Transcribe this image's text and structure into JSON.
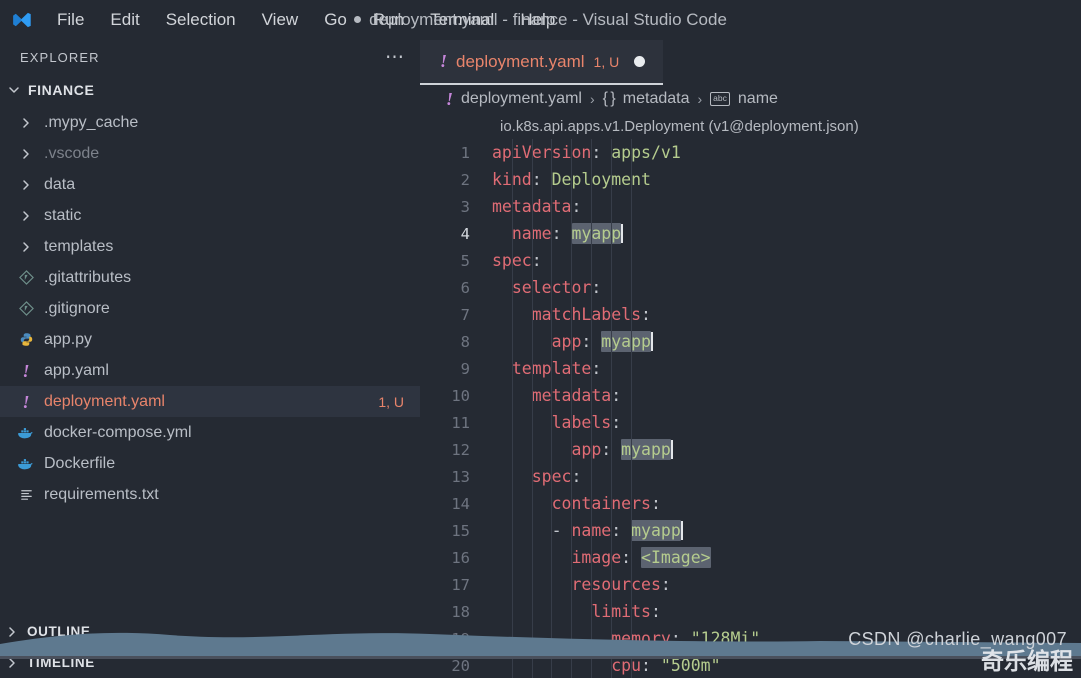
{
  "titlebar": {
    "logo_icon": "vscode-logo-icon",
    "menus": [
      "File",
      "Edit",
      "Selection",
      "View",
      "Go",
      "Run",
      "Terminal",
      "Help"
    ],
    "window_title": "deployment.yaml - finance - Visual Studio Code",
    "dirty_indicator": "●"
  },
  "sidebar": {
    "header_label": "EXPLORER",
    "more_actions_icon": "ellipsis-icon",
    "project": {
      "label": "FINANCE",
      "expanded": true,
      "chevron_icon": "chevron-down-icon"
    },
    "items": [
      {
        "label": ".mypy_cache",
        "type": "folder",
        "icon": "chevron-right-icon",
        "dim": false,
        "selected": false,
        "badge": ""
      },
      {
        "label": ".vscode",
        "type": "folder",
        "icon": "chevron-right-icon",
        "dim": true,
        "selected": false,
        "badge": ""
      },
      {
        "label": "data",
        "type": "folder",
        "icon": "chevron-right-icon",
        "dim": false,
        "selected": false,
        "badge": ""
      },
      {
        "label": "static",
        "type": "folder",
        "icon": "chevron-right-icon",
        "dim": false,
        "selected": false,
        "badge": ""
      },
      {
        "label": "templates",
        "type": "folder",
        "icon": "chevron-right-icon",
        "dim": false,
        "selected": false,
        "badge": ""
      },
      {
        "label": ".gitattributes",
        "type": "file",
        "icon": "git-icon",
        "dim": false,
        "selected": false,
        "badge": ""
      },
      {
        "label": ".gitignore",
        "type": "file",
        "icon": "git-icon",
        "dim": false,
        "selected": false,
        "badge": ""
      },
      {
        "label": "app.py",
        "type": "file",
        "icon": "python-icon",
        "dim": false,
        "selected": false,
        "badge": ""
      },
      {
        "label": "app.yaml",
        "type": "file",
        "icon": "yaml-warning-icon",
        "dim": false,
        "selected": false,
        "badge": ""
      },
      {
        "label": "deployment.yaml",
        "type": "file",
        "icon": "yaml-warning-icon",
        "dim": false,
        "selected": true,
        "badge": "1, U"
      },
      {
        "label": "docker-compose.yml",
        "type": "file",
        "icon": "docker-icon",
        "dim": false,
        "selected": false,
        "badge": ""
      },
      {
        "label": "Dockerfile",
        "type": "file",
        "icon": "docker-icon",
        "dim": false,
        "selected": false,
        "badge": ""
      },
      {
        "label": "requirements.txt",
        "type": "file",
        "icon": "text-lines-icon",
        "dim": false,
        "selected": false,
        "badge": ""
      }
    ],
    "panels": [
      {
        "label": "OUTLINE",
        "icon": "chevron-right-icon"
      },
      {
        "label": "TIMELINE",
        "icon": "chevron-right-icon"
      }
    ]
  },
  "editor": {
    "tab": {
      "icon": "yaml-warning-icon",
      "name": "deployment.yaml",
      "badge": "1, U",
      "dirty_icon": "dirty-dot-icon"
    },
    "breadcrumb": {
      "file_icon": "yaml-warning-icon",
      "file": "deployment.yaml",
      "separator": "›",
      "object_icon": "{ }",
      "object": "metadata",
      "symbol_icon": "abc",
      "symbol": "name"
    },
    "type_info": "io.k8s.api.apps.v1.Deployment (v1@deployment.json)",
    "active_line": 4,
    "lines": [
      {
        "n": "1",
        "indent": 0,
        "tokens": [
          {
            "t": "apiVersion",
            "c": "k"
          },
          {
            "t": ": ",
            "c": "p"
          },
          {
            "t": "apps/v1",
            "c": "v"
          }
        ]
      },
      {
        "n": "2",
        "indent": 0,
        "tokens": [
          {
            "t": "kind",
            "c": "k"
          },
          {
            "t": ": ",
            "c": "p"
          },
          {
            "t": "Deployment",
            "c": "v"
          }
        ]
      },
      {
        "n": "3",
        "indent": 0,
        "tokens": [
          {
            "t": "metadata",
            "c": "k"
          },
          {
            "t": ":",
            "c": "p"
          }
        ]
      },
      {
        "n": "4",
        "indent": 1,
        "tokens": [
          {
            "t": "name",
            "c": "k"
          },
          {
            "t": ": ",
            "c": "p"
          },
          {
            "t": "myapp",
            "c": "v",
            "sel": true,
            "caret": true
          }
        ]
      },
      {
        "n": "5",
        "indent": 0,
        "tokens": [
          {
            "t": "spec",
            "c": "k"
          },
          {
            "t": ":",
            "c": "p"
          }
        ]
      },
      {
        "n": "6",
        "indent": 1,
        "tokens": [
          {
            "t": "selector",
            "c": "k"
          },
          {
            "t": ":",
            "c": "p"
          }
        ]
      },
      {
        "n": "7",
        "indent": 2,
        "tokens": [
          {
            "t": "matchLabels",
            "c": "k"
          },
          {
            "t": ":",
            "c": "p"
          }
        ]
      },
      {
        "n": "8",
        "indent": 3,
        "tokens": [
          {
            "t": "app",
            "c": "k"
          },
          {
            "t": ": ",
            "c": "p"
          },
          {
            "t": "myapp",
            "c": "v",
            "sel": true,
            "caret": true
          }
        ]
      },
      {
        "n": "9",
        "indent": 1,
        "tokens": [
          {
            "t": "template",
            "c": "k"
          },
          {
            "t": ":",
            "c": "p"
          }
        ]
      },
      {
        "n": "10",
        "indent": 2,
        "tokens": [
          {
            "t": "metadata",
            "c": "k"
          },
          {
            "t": ":",
            "c": "p"
          }
        ]
      },
      {
        "n": "11",
        "indent": 3,
        "tokens": [
          {
            "t": "labels",
            "c": "k"
          },
          {
            "t": ":",
            "c": "p"
          }
        ]
      },
      {
        "n": "12",
        "indent": 4,
        "tokens": [
          {
            "t": "app",
            "c": "k"
          },
          {
            "t": ": ",
            "c": "p"
          },
          {
            "t": "myapp",
            "c": "v",
            "sel": true,
            "caret": true
          }
        ]
      },
      {
        "n": "13",
        "indent": 2,
        "tokens": [
          {
            "t": "spec",
            "c": "k"
          },
          {
            "t": ":",
            "c": "p"
          }
        ]
      },
      {
        "n": "14",
        "indent": 3,
        "tokens": [
          {
            "t": "containers",
            "c": "k"
          },
          {
            "t": ":",
            "c": "p"
          }
        ]
      },
      {
        "n": "15",
        "indent": 3,
        "tokens": [
          {
            "t": "- ",
            "c": "p"
          },
          {
            "t": "name",
            "c": "k"
          },
          {
            "t": ": ",
            "c": "p"
          },
          {
            "t": "myapp",
            "c": "v",
            "sel": true,
            "caret": true
          }
        ]
      },
      {
        "n": "16",
        "indent": 4,
        "tokens": [
          {
            "t": "image",
            "c": "k"
          },
          {
            "t": ": ",
            "c": "p"
          },
          {
            "t": "<Image>",
            "c": "v",
            "sel": true
          }
        ]
      },
      {
        "n": "17",
        "indent": 4,
        "tokens": [
          {
            "t": "resources",
            "c": "k"
          },
          {
            "t": ":",
            "c": "p"
          }
        ]
      },
      {
        "n": "18",
        "indent": 5,
        "tokens": [
          {
            "t": "limits",
            "c": "k"
          },
          {
            "t": ":",
            "c": "p"
          }
        ]
      },
      {
        "n": "19",
        "indent": 6,
        "tokens": [
          {
            "t": "memory",
            "c": "k"
          },
          {
            "t": ": ",
            "c": "p"
          },
          {
            "t": "\"128Mi\"",
            "c": "v"
          }
        ]
      },
      {
        "n": "20",
        "indent": 6,
        "tokens": [
          {
            "t": "cpu",
            "c": "k"
          },
          {
            "t": ": ",
            "c": "p"
          },
          {
            "t": "\"500m\"",
            "c": "v"
          }
        ]
      }
    ]
  },
  "overlay": {
    "watermark": "CSDN @charlie_wang007",
    "watermark_cn": "奇乐编程"
  },
  "colors": {
    "background": "#252a33",
    "sidebar_selected": "#2e3440",
    "accent_file": "#e8846b",
    "yaml_key": "#e06c75",
    "yaml_value": "#b5cc8e",
    "warning_icon": "#c586d9",
    "scrollbar": "#5e798f"
  }
}
